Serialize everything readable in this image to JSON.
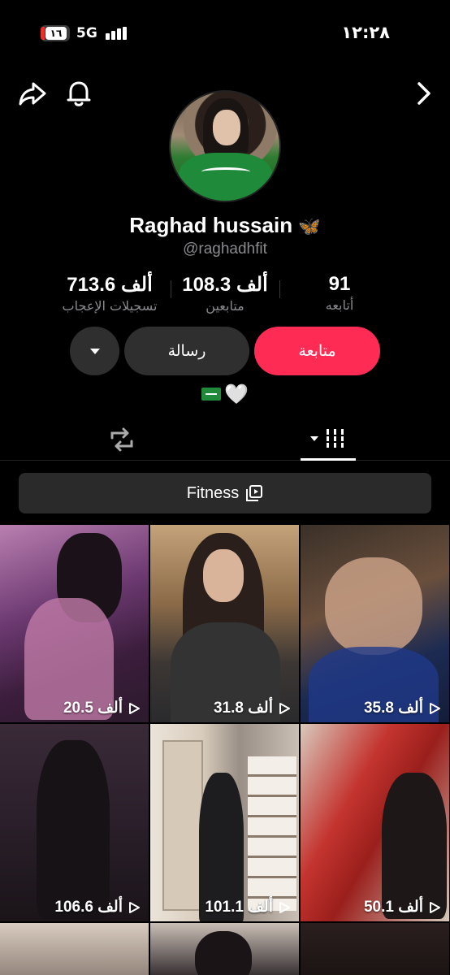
{
  "status_bar": {
    "battery_level": "١٦",
    "network": "5G",
    "time": "١٢:٢٨"
  },
  "profile": {
    "display_name": "Raghad hussain",
    "name_emoji": "🦋",
    "handle": "@raghadhfit",
    "bio_emoji": "🤍",
    "stats": {
      "likes_value": "713.6 ألف",
      "likes_label": "تسجيلات الإعجاب",
      "followers_value": "108.3 ألف",
      "followers_label": "متابعين",
      "following_value": "91",
      "following_label": "أتابعه"
    }
  },
  "actions": {
    "follow_label": "متابعة",
    "message_label": "رسالة"
  },
  "collection": {
    "label": "Fitness"
  },
  "videos": [
    {
      "views": "20.5 ألف"
    },
    {
      "views": "31.8 ألف"
    },
    {
      "views": "35.8 ألف"
    },
    {
      "views": "106.6 ألف"
    },
    {
      "views": "101.1 ألف"
    },
    {
      "views": "50.1 ألف"
    },
    {
      "views": ""
    },
    {
      "views": ""
    },
    {
      "views": ""
    }
  ],
  "colors": {
    "follow_button": "#fe2c55",
    "secondary_button": "#2f2f2f",
    "background": "#000000",
    "muted_text": "#8a8a8e"
  }
}
